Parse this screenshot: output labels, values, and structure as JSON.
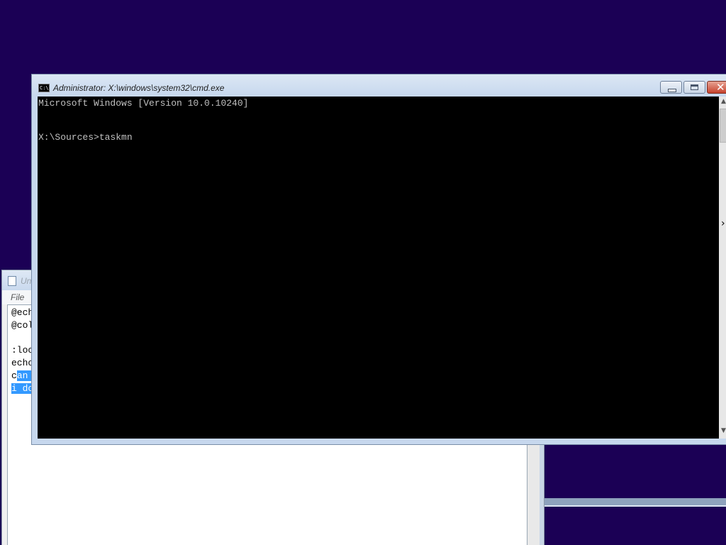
{
  "desktop": {
    "background_color": "#1b0055"
  },
  "notepad": {
    "title_partial": "Un",
    "menu": {
      "file_label": "File"
    },
    "lines": [
      {
        "plain": "@ech",
        "selected": ""
      },
      {
        "plain": "@col",
        "selected": ""
      },
      {
        "plain": "",
        "selected": ""
      },
      {
        "plain": ":loo",
        "selected": ""
      },
      {
        "plain": "echo",
        "selected": ""
      },
      {
        "plain": "c",
        "selected": "an "
      },
      {
        "plain": "",
        "selected": "i do"
      }
    ],
    "selection_color": "#3399ff"
  },
  "cmd": {
    "title": "Administrator: X:\\windows\\system32\\cmd.exe",
    "icon_text": "C:\\",
    "console_lines": [
      "Microsoft Windows [Version 10.0.10240]",
      "",
      "",
      "X:\\Sources>taskmn"
    ],
    "console_background": "#000000",
    "console_text_color": "#c0c0c0",
    "buttons": {
      "minimize": "minimize",
      "maximize": "maximize",
      "close": "close"
    }
  },
  "icons": {
    "close_glyph": "✕",
    "scroll_up_glyph": "▲",
    "scroll_down_glyph": "▼",
    "cursor_glyph": "›"
  }
}
